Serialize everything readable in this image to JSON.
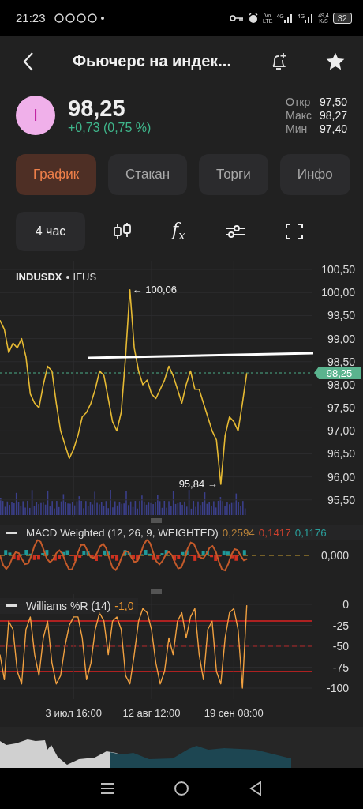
{
  "status_bar": {
    "time": "21:23",
    "volte": "Vo",
    "volte_sub": "LTE",
    "networks": [
      "4G",
      "4G"
    ],
    "speed": "49,4",
    "speed_unit": "K/S",
    "battery": "32"
  },
  "header": {
    "title": "Фьючерс на индек..."
  },
  "quote": {
    "avatar_letter": "I",
    "price": "98,25",
    "change": "+0,73 (0,75 %)",
    "stats": [
      {
        "label": "Откр",
        "value": "97,50"
      },
      {
        "label": "Макс",
        "value": "98,27"
      },
      {
        "label": "Мин",
        "value": "97,40"
      }
    ]
  },
  "tabs": [
    {
      "label": "График",
      "selected": true
    },
    {
      "label": "Стакан",
      "selected": false
    },
    {
      "label": "Торги",
      "selected": false
    },
    {
      "label": "Инфо",
      "selected": false
    }
  ],
  "toolbar": [
    {
      "kind": "interval",
      "label": "4 час"
    },
    {
      "kind": "candles"
    },
    {
      "kind": "formula",
      "label": "f",
      "sub": "x"
    },
    {
      "kind": "settings"
    },
    {
      "kind": "fullscreen"
    }
  ],
  "price_chart": {
    "exchange": "IFUS",
    "last_price_label": "98,25",
    "chart_data": {
      "type": "line",
      "grid": true,
      "ylim": [
        95.12,
        100.69
      ],
      "yticks": [
        {
          "value": 100.5,
          "label": "100,50"
        },
        {
          "value": 100,
          "label": "100,00"
        },
        {
          "value": 99.5,
          "label": "99,50"
        },
        {
          "value": 99,
          "label": "99,00"
        },
        {
          "value": 98.5,
          "label": "98,50"
        },
        {
          "value": 98,
          "label": "98,00"
        },
        {
          "value": 97.5,
          "label": "97,50"
        },
        {
          "value": 97,
          "label": "97,00"
        },
        {
          "value": 96.5,
          "label": "96,50"
        },
        {
          "value": 96,
          "label": "96,00"
        },
        {
          "value": 95.5,
          "label": "95,50"
        }
      ],
      "series": [
        {
          "name": "INDUSDX",
          "color": "#e5b933",
          "values": [
            99.4,
            99.2,
            98.7,
            98.9,
            98.8,
            99.0,
            98.6,
            97.8,
            97.6,
            97.5,
            98.0,
            98.4,
            98.3,
            97.6,
            97.0,
            96.7,
            96.4,
            96.6,
            96.9,
            97.3,
            97.4,
            97.6,
            97.9,
            98.3,
            98.2,
            97.7,
            97.2,
            97.0,
            97.4,
            98.6,
            100.06,
            98.8,
            98.3,
            98.0,
            98.1,
            97.8,
            97.7,
            97.9,
            98.1,
            98.4,
            98.2,
            97.9,
            97.6,
            98.0,
            98.3,
            97.9,
            97.9,
            97.6,
            97.3,
            97.0,
            96.8,
            95.84,
            96.9,
            97.3,
            97.2,
            97.0,
            97.6,
            98.25
          ]
        }
      ],
      "annotations": [
        "← 100,06",
        "95,84 →"
      ]
    }
  },
  "macd": {
    "title": "MACD Weighted (12, 26, 9, WEIGHTED)",
    "values": [
      {
        "text": "0,2594",
        "color": "#b8823a"
      },
      {
        "text": "0,1417",
        "color": "#c9402e"
      },
      {
        "text": "0,1176",
        "color": "#2a9d9a"
      }
    ],
    "zero_label": "0,000"
  },
  "williams": {
    "value": "-1,0",
    "chart_data": {
      "type": "line",
      "grid": true,
      "categories": [
        null,
        null,
        null,
        null,
        null,
        null,
        null,
        null,
        null,
        null,
        null,
        null,
        null,
        null,
        null,
        null,
        null,
        "3 июл 16:00",
        null,
        null,
        null,
        null,
        null,
        null,
        null,
        null,
        null,
        null,
        null,
        null,
        null,
        null,
        null,
        null,
        null,
        "12 авг 12:00",
        null,
        null,
        null,
        null,
        null,
        null,
        null,
        null,
        null,
        null,
        null,
        null,
        null,
        null,
        null,
        null,
        null,
        null,
        "19 сен 08:00",
        null,
        null,
        null
      ],
      "ylim": [
        -113.2,
        12.3
      ],
      "yticks": [
        {
          "value": 0,
          "label": "0"
        },
        {
          "value": -25,
          "label": "-25"
        },
        {
          "value": -50,
          "label": "-50"
        },
        {
          "value": -75,
          "label": "-75"
        },
        {
          "value": -100,
          "label": "-100"
        }
      ],
      "series": [
        {
          "name": "Williams %R (14)",
          "color": "#f0a040",
          "values": [
            -60,
            -90,
            -20,
            -30,
            -80,
            -95,
            -30,
            -15,
            -60,
            -85,
            -40,
            -20,
            -70,
            -95,
            -85,
            -50,
            -25,
            -15,
            -15,
            -40,
            -90,
            -70,
            -30,
            -10,
            -20,
            -60,
            -20,
            -15,
            -30,
            -85,
            -95,
            -60,
            -20,
            -5,
            -10,
            -30,
            -70,
            -95,
            -80,
            -40,
            -60,
            -20,
            -10,
            -40,
            -15,
            -5,
            -60,
            -90,
            -30,
            -20,
            -80,
            -95,
            -40,
            -10,
            -5,
            -30,
            -100,
            -1
          ]
        }
      ]
    }
  }
}
